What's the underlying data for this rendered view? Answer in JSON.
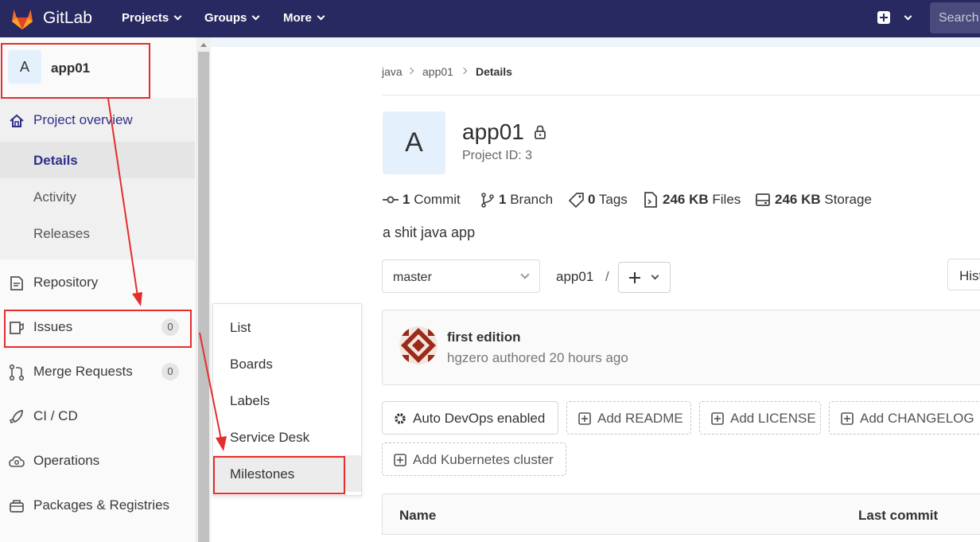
{
  "topbar": {
    "brand": "GitLab",
    "nav": [
      "Projects",
      "Groups",
      "More"
    ],
    "search_placeholder": "Search"
  },
  "sidebar": {
    "project_initial": "A",
    "project_name": "app01",
    "overview_label": "Project overview",
    "overview_sub": [
      "Details",
      "Activity",
      "Releases"
    ],
    "repository": "Repository",
    "issues": "Issues",
    "issues_count": "0",
    "merge_requests": "Merge Requests",
    "merge_requests_count": "0",
    "cicd": "CI / CD",
    "operations": "Operations",
    "packages": "Packages & Registries"
  },
  "flyout": {
    "items": [
      "List",
      "Boards",
      "Labels",
      "Service Desk",
      "Milestones"
    ]
  },
  "breadcrumb": [
    "java",
    "app01",
    "Details"
  ],
  "project": {
    "initial": "A",
    "title": "app01",
    "project_id": "Project ID: 3",
    "description": "a shit java app"
  },
  "stats": {
    "commits_n": "1",
    "commits_l": "Commit",
    "branches_n": "1",
    "branches_l": "Branch",
    "tags_n": "0",
    "tags_l": "Tags",
    "files_n": "246 KB",
    "files_l": "Files",
    "storage_n": "246 KB",
    "storage_l": "Storage"
  },
  "repo_bar": {
    "branch": "master",
    "path": "app01",
    "slash": "/",
    "history": "History"
  },
  "last_commit": {
    "title": "first edition",
    "meta": "hgzero authored 20 hours ago"
  },
  "actions": {
    "autodevops": "Auto DevOps enabled",
    "readme": "Add README",
    "license": "Add LICENSE",
    "changelog": "Add CHANGELOG",
    "k8s": "Add Kubernetes cluster"
  },
  "table": {
    "col_name": "Name",
    "col_commit": "Last commit"
  },
  "colors": {
    "topbar": "#292961",
    "highlight": "#e52d2d"
  }
}
